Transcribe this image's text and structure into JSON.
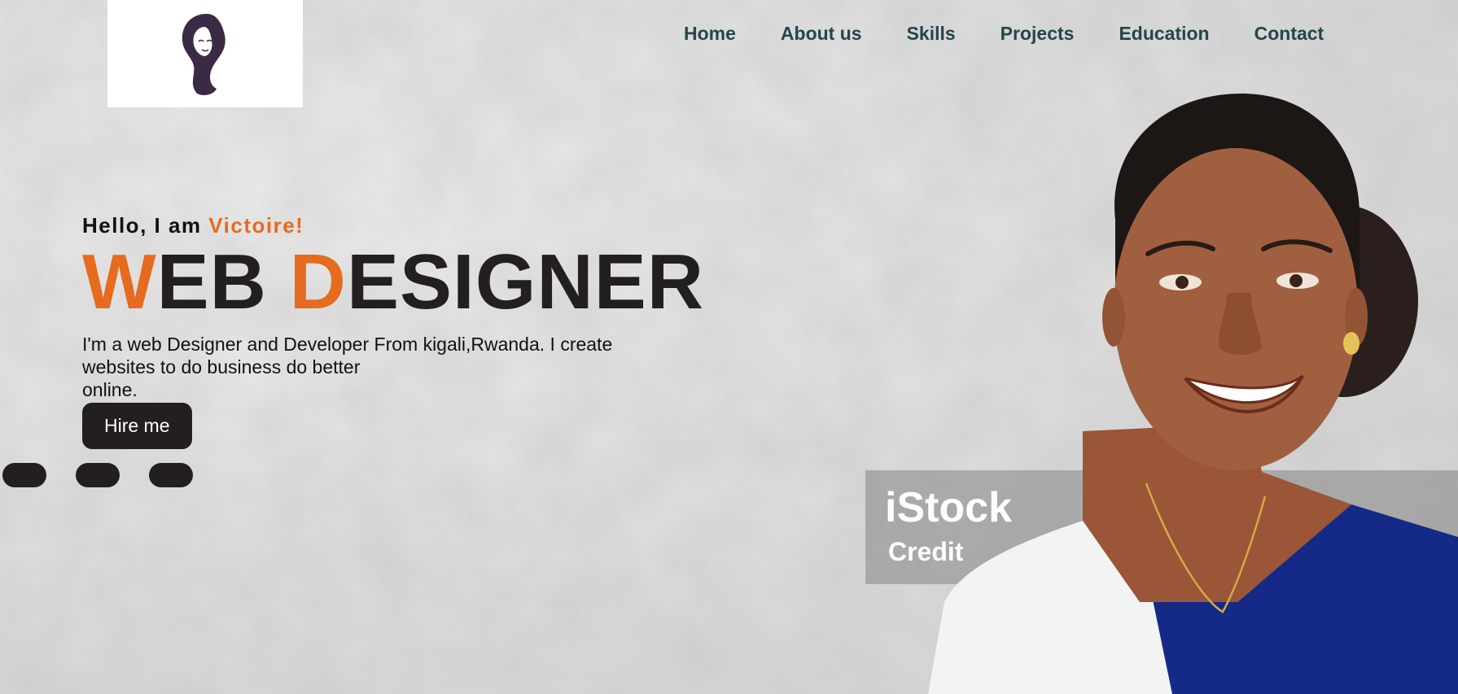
{
  "logo": {
    "alt": "woman silhouette logo"
  },
  "nav": {
    "items": [
      {
        "label": "Home"
      },
      {
        "label": "About us"
      },
      {
        "label": "Skills"
      },
      {
        "label": "Projects"
      },
      {
        "label": "Education"
      },
      {
        "label": "Contact"
      }
    ]
  },
  "hero": {
    "greeting_prefix": "Hello, I am ",
    "greeting_name": "Victoire!",
    "title_part1_accent": "W",
    "title_part1_rest": "EB ",
    "title_part2_accent": "D",
    "title_part2_rest": "ESIGNER",
    "description_line1": "I'm a web Designer and Developer From kigali,Rwanda. I create",
    "description_line2": "websites to do business do better",
    "description_line3": "online.",
    "cta_label": "Hire me"
  },
  "socials": [
    {
      "icon": "social-icon"
    },
    {
      "icon": "social-icon"
    },
    {
      "icon": "social-icon"
    }
  ],
  "photo_watermark": {
    "brand": "iStock",
    "credit": "Credit"
  },
  "colors": {
    "accent": "#e66b1e",
    "dark": "#231f20",
    "nav_text": "#24464c"
  }
}
